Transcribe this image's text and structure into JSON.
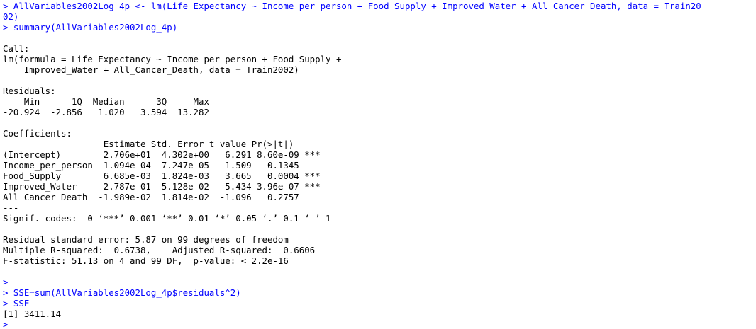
{
  "colors": {
    "background": "#ffffff",
    "input_text": "#0000ff",
    "output_text": "#000000"
  },
  "console": {
    "lines": [
      {
        "kind": "input",
        "text": "> AllVariables2002Log_4p <- lm(Life_Expectancy ~ Income_per_person + Food_Supply + Improved_Water + All_Cancer_Death, data = Train20"
      },
      {
        "kind": "input",
        "text": "02)"
      },
      {
        "kind": "input",
        "text": "> summary(AllVariables2002Log_4p)"
      },
      {
        "kind": "blank",
        "text": ""
      },
      {
        "kind": "output",
        "text": "Call:"
      },
      {
        "kind": "output",
        "text": "lm(formula = Life_Expectancy ~ Income_per_person + Food_Supply + "
      },
      {
        "kind": "output",
        "text": "    Improved_Water + All_Cancer_Death, data = Train2002)"
      },
      {
        "kind": "blank",
        "text": ""
      },
      {
        "kind": "output",
        "text": "Residuals:"
      },
      {
        "kind": "output",
        "text": "    Min      1Q  Median      3Q     Max "
      },
      {
        "kind": "output",
        "text": "-20.924  -2.856   1.020   3.594  13.282 "
      },
      {
        "kind": "blank",
        "text": ""
      },
      {
        "kind": "output",
        "text": "Coefficients:"
      },
      {
        "kind": "output",
        "text": "                   Estimate Std. Error t value Pr(>|t|)    "
      },
      {
        "kind": "output",
        "text": "(Intercept)        2.706e+01  4.302e+00   6.291 8.60e-09 ***"
      },
      {
        "kind": "output",
        "text": "Income_per_person  1.094e-04  7.247e-05   1.509   0.1345    "
      },
      {
        "kind": "output",
        "text": "Food_Supply        6.685e-03  1.824e-03   3.665   0.0004 ***"
      },
      {
        "kind": "output",
        "text": "Improved_Water     2.787e-01  5.128e-02   5.434 3.96e-07 ***"
      },
      {
        "kind": "output",
        "text": "All_Cancer_Death  -1.989e-02  1.814e-02  -1.096   0.2757    "
      },
      {
        "kind": "output",
        "text": "---"
      },
      {
        "kind": "output",
        "text": "Signif. codes:  0 ‘***’ 0.001 ‘**’ 0.01 ‘*’ 0.05 ‘.’ 0.1 ‘ ’ 1"
      },
      {
        "kind": "blank",
        "text": ""
      },
      {
        "kind": "output",
        "text": "Residual standard error: 5.87 on 99 degrees of freedom"
      },
      {
        "kind": "output",
        "text": "Multiple R-squared:  0.6738,    Adjusted R-squared:  0.6606 "
      },
      {
        "kind": "output",
        "text": "F-statistic: 51.13 on 4 and 99 DF,  p-value: < 2.2e-16"
      },
      {
        "kind": "blank",
        "text": ""
      },
      {
        "kind": "input",
        "text": "> "
      },
      {
        "kind": "input",
        "text": "> SSE=sum(AllVariables2002Log_4p$residuals^2)"
      },
      {
        "kind": "input",
        "text": "> SSE"
      },
      {
        "kind": "output",
        "text": "[1] 3411.14"
      },
      {
        "kind": "input",
        "text": "> "
      }
    ]
  }
}
